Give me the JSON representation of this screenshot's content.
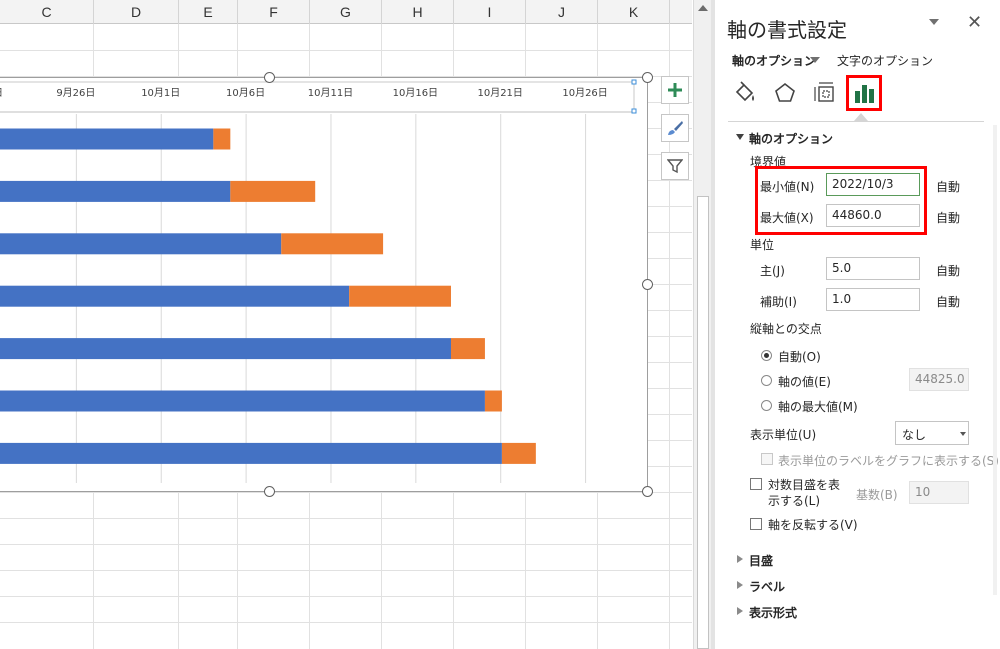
{
  "sheet": {
    "columns": [
      "C",
      "D",
      "E",
      "F",
      "G",
      "H",
      "I",
      "J",
      "K"
    ]
  },
  "chart_data": {
    "type": "bar",
    "orientation": "horizontal",
    "stacked": true,
    "x_axis_position": "top",
    "x_tick_labels": [
      "9月26日",
      "10月1日",
      "10月6日",
      "10月11日",
      "10月16日",
      "10月21日",
      "10月26日"
    ],
    "x_ticks": [
      5,
      10,
      15,
      20,
      25,
      30,
      35
    ],
    "first_tick_partial_label": "日",
    "xlim": [
      0,
      38
    ],
    "series": [
      {
        "values": [
          13.1,
          14.1,
          17.1,
          21.1,
          27.1,
          29.1,
          30.1
        ],
        "color": "#4472c4"
      },
      {
        "values": [
          1.0,
          5.0,
          6.0,
          6.0,
          2.0,
          1.0,
          2.0
        ],
        "color": "#ed7d31"
      }
    ],
    "grid": "vertical"
  },
  "pane": {
    "title": "軸の書式設定",
    "close": "✕",
    "tab_axis_options": "軸のオプション",
    "tab_text_options": "文字のオプション",
    "icons": [
      "fill-line-icon",
      "effects-icon",
      "size-properties-icon",
      "axis-options-icon"
    ],
    "section_axis_options": "軸のオプション",
    "bounds_label": "境界値",
    "min_label": "最小値(N)",
    "min_value": "2022/10/3",
    "min_auto": "自動",
    "max_label": "最大値(X)",
    "max_value": "44860.0",
    "max_auto": "自動",
    "units_label": "単位",
    "major_label": "主(J)",
    "major_value": "5.0",
    "major_auto": "自動",
    "minor_label": "補助(I)",
    "minor_value": "1.0",
    "minor_auto": "自動",
    "cross_label": "縦軸との交点",
    "cross_auto": "自動(O)",
    "cross_value_label": "軸の値(E)",
    "cross_value": "44825.0",
    "cross_max": "軸の最大値(M)",
    "display_units_label": "表示単位(U)",
    "display_units_value": "なし",
    "show_units_label": "表示単位のラベルをグラフに表示する(S)",
    "log_scale_line1": "対数目盛を表",
    "log_scale_line2": "示する(L)",
    "base_label": "基数(B)",
    "base_value": "10",
    "reverse_label": "軸を反転する(V)",
    "section_ticks": "目盛",
    "section_labels": "ラベル",
    "section_number": "表示形式"
  },
  "colors": {
    "series_blue": "#4472c4",
    "series_orange": "#ed7d31",
    "highlight_red": "#ff0000",
    "excel_green": "#217346"
  }
}
